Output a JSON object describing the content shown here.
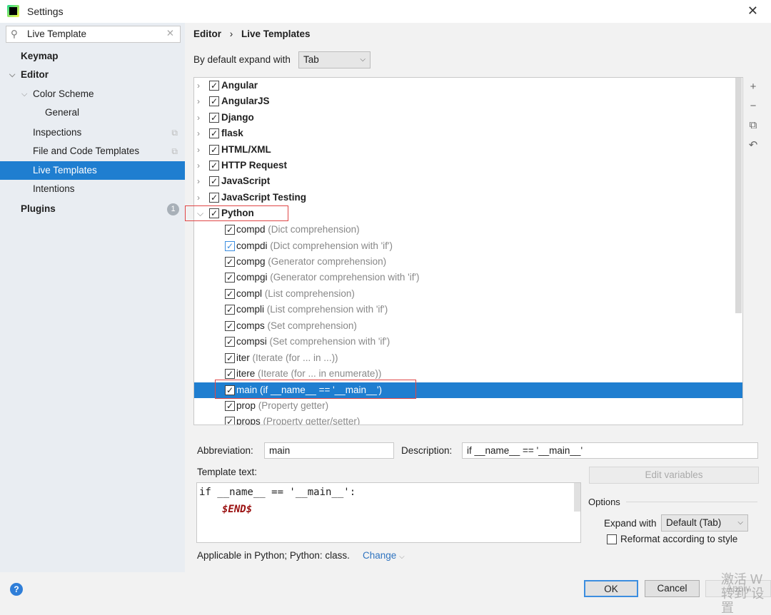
{
  "window": {
    "title": "Settings",
    "close_icon": "close-icon"
  },
  "search": {
    "value": "Live Template"
  },
  "sidebar": {
    "items": [
      {
        "label": "Keymap"
      },
      {
        "label": "Editor"
      },
      {
        "label": "Color Scheme"
      },
      {
        "label": "General"
      },
      {
        "label": "Inspections"
      },
      {
        "label": "File and Code Templates"
      },
      {
        "label": "Live Templates"
      },
      {
        "label": "Intentions"
      },
      {
        "label": "Plugins",
        "badge": "1"
      }
    ]
  },
  "breadcrumb": {
    "parent": "Editor",
    "sep": "›",
    "current": "Live Templates"
  },
  "expand": {
    "label": "By default expand with",
    "value": "Tab"
  },
  "groups": [
    "Angular",
    "AngularJS",
    "Django",
    "flask",
    "HTML/XML",
    "HTTP Request",
    "JavaScript",
    "JavaScript Testing",
    "Python"
  ],
  "python_items": [
    {
      "abbr": "compd",
      "desc": "(Dict comprehension)"
    },
    {
      "abbr": "compdi",
      "desc": "(Dict comprehension with 'if')"
    },
    {
      "abbr": "compg",
      "desc": "(Generator comprehension)"
    },
    {
      "abbr": "compgi",
      "desc": "(Generator comprehension with 'if')"
    },
    {
      "abbr": "compl",
      "desc": "(List comprehension)"
    },
    {
      "abbr": "compli",
      "desc": "(List comprehension with 'if')"
    },
    {
      "abbr": "comps",
      "desc": "(Set comprehension)"
    },
    {
      "abbr": "compsi",
      "desc": "(Set comprehension with 'if')"
    },
    {
      "abbr": "iter",
      "desc": "(Iterate (for ... in ...))"
    },
    {
      "abbr": "itere",
      "desc": "(Iterate (for ... in enumerate))"
    },
    {
      "abbr": "main",
      "desc": "(if __name__ == '__main__')"
    },
    {
      "abbr": "prop",
      "desc": "(Property getter)"
    },
    {
      "abbr": "props",
      "desc": "(Property getter/setter)"
    }
  ],
  "editor": {
    "abbr_label": "Abbreviation:",
    "abbr_value": "main",
    "desc_label": "Description:",
    "desc_value": "if __name__ == '__main__'",
    "template_label": "Template text:",
    "template_line1": "if __name__ == '__main__':",
    "template_line2": "$END$",
    "edit_variables": "Edit variables",
    "options_label": "Options",
    "expand_with_label": "Expand with",
    "expand_with_value": "Default (Tab)",
    "reformat_label": "Reformat according to style",
    "applicable": "Applicable in Python; Python: class.",
    "change": "Change"
  },
  "footer": {
    "ok": "OK",
    "cancel": "Cancel",
    "apply": "Apply",
    "watermark": "激活 W 转到\"设置"
  },
  "colors": {
    "selection": "#1f7ed0",
    "link": "#2f74c0",
    "highlight_box": "#e04646"
  }
}
